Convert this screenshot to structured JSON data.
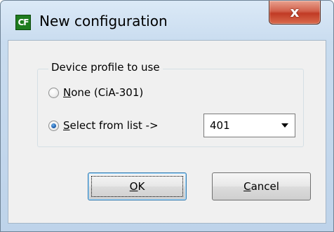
{
  "window": {
    "title": "New configuration",
    "app_icon_text": "CF",
    "close_glyph": "x"
  },
  "group": {
    "legend": "Device profile to use"
  },
  "options": {
    "none": {
      "accel": "N",
      "rest": "one (CiA-301)",
      "checked": false
    },
    "select": {
      "accel": "S",
      "rest": "elect from list  ->",
      "checked": true
    }
  },
  "profile_select": {
    "value": "401"
  },
  "buttons": {
    "ok": {
      "accel": "O",
      "rest": "K"
    },
    "cancel": {
      "accel": "C",
      "rest": "ancel"
    }
  },
  "colors": {
    "close_button": "#c13b25",
    "default_button_border": "#3c7fb1",
    "radio_dot": "#1d5fae"
  }
}
